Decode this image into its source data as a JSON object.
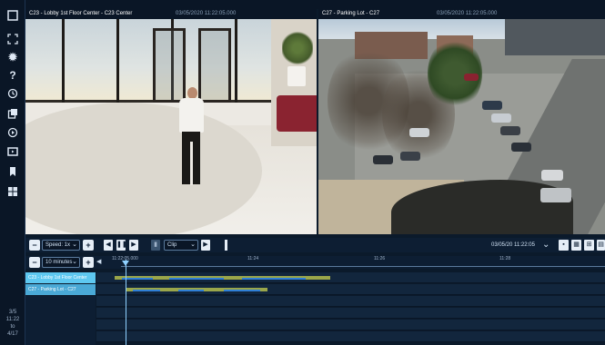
{
  "sidebar": {
    "icons": [
      "layout-icon",
      "fullscreen-icon",
      "settings-icon",
      "help-icon",
      "history-icon",
      "export-icon",
      "playback-icon",
      "camera-icon",
      "bookmark-icon",
      "tile-icon"
    ],
    "date_lines": [
      "3/5",
      "11:22",
      "to",
      "4/17"
    ]
  },
  "panes": [
    {
      "title": "C23 - Lobby 1st Floor Center - C23 Center",
      "timestamp": "03/05/2020 11:22:05.000"
    },
    {
      "title": "C27 - Parking Lot - C27",
      "timestamp": "03/05/2020 11:22:05.000"
    }
  ],
  "controls": {
    "speed_value": "Speed: 1x",
    "clip_value": "Clip",
    "datetime": "03/05/20 11:22:05",
    "minus_symbol": "−",
    "plus_symbol": "+"
  },
  "timeline": {
    "zoom_value": "10 minutes",
    "ticks": [
      "11:22:05.000",
      "11:24",
      "11:26",
      "11:28"
    ],
    "tracks": [
      {
        "label": "C23 - Lobby 1st Floor Center",
        "selected": true
      },
      {
        "label": "C27 - Parking Lot - C27",
        "selected": false
      }
    ],
    "colors": {
      "motion": "#9aa64a",
      "recording": "#2f7fd6",
      "selected": "#5ec8f0"
    }
  }
}
